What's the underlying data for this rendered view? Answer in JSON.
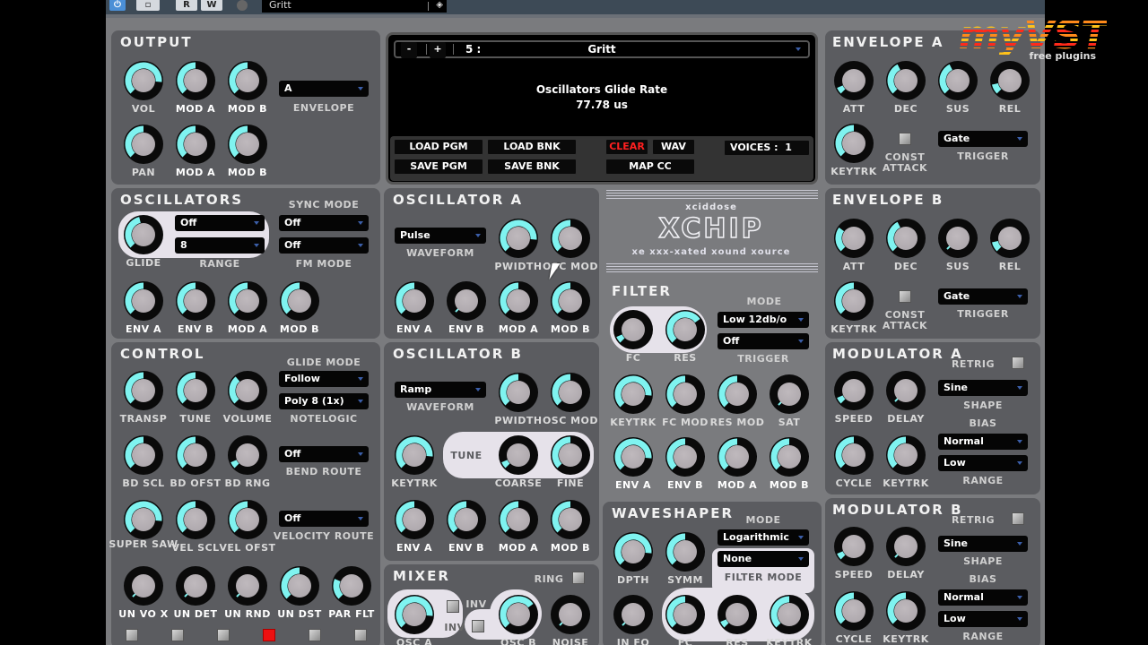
{
  "host": {
    "buttons": [
      "⏻",
      "▫",
      "R",
      "W"
    ],
    "preset_name": "Gritt"
  },
  "watermark": {
    "brand": "myVST",
    "tagline": "free plugins"
  },
  "display": {
    "prev": "-",
    "next": "+",
    "program_number": "5 :",
    "program_name": "Gritt",
    "param_name": "Oscillators Glide Rate",
    "param_value": "77.78 us",
    "load_pgm": "LOAD PGM",
    "load_bnk": "LOAD BNK",
    "save_pgm": "SAVE PGM",
    "save_bnk": "SAVE BNK",
    "clear": "CLEAR",
    "wav": "WAV",
    "map_cc": "MAP CC",
    "voices_label": "VOICES :",
    "voices_value": "1"
  },
  "logo": {
    "maker": "xciddose",
    "name": "XCHIP",
    "tagline": "xe xxx-xated xound xource"
  },
  "output": {
    "title": "OUTPUT",
    "knobs": [
      {
        "label": "VOL",
        "value": 0.85
      },
      {
        "label": "MOD A",
        "value": 0.5
      },
      {
        "label": "MOD B",
        "value": 0.5
      },
      {
        "label": "PAN",
        "value": 0.5
      },
      {
        "label": "MOD A",
        "value": 0.5
      },
      {
        "label": "MOD B",
        "value": 0.5
      }
    ],
    "envelope_select": "A",
    "envelope_label": "ENVELOPE"
  },
  "oscillators": {
    "title": "OSCILLATORS",
    "glide": {
      "label": "GLIDE",
      "value": 0.45
    },
    "range_selects": [
      "Off",
      "8"
    ],
    "range_label": "RANGE",
    "sync_label": "SYNC MODE",
    "sync_select": "Off",
    "fm_select": "Off",
    "fm_label": "FM MODE",
    "knobs": [
      {
        "label": "ENV A",
        "value": 0.5
      },
      {
        "label": "ENV B",
        "value": 0.5
      },
      {
        "label": "MOD A",
        "value": 0.5
      },
      {
        "label": "MOD B",
        "value": 0.5
      }
    ]
  },
  "control": {
    "title": "CONTROL",
    "knobs": [
      {
        "label": "TRANSP",
        "value": 0.5
      },
      {
        "label": "TUNE",
        "value": 0.5
      },
      {
        "label": "VOLUME",
        "value": 0.35
      },
      {
        "label": "BD SCL",
        "value": 0.5
      },
      {
        "label": "BD OFST",
        "value": 0.5
      },
      {
        "label": "BD RNG",
        "value": 0.08
      },
      {
        "label": "SUPER SAW",
        "value": 0.85
      },
      {
        "label": "VEL SCL",
        "value": 0.5
      },
      {
        "label": "VEL OFST",
        "value": 0.5
      },
      {
        "label": "UN VO X",
        "value": 0.0
      },
      {
        "label": "UN DET",
        "value": 0.0
      },
      {
        "label": "UN RND",
        "value": 0.0
      },
      {
        "label": "UN DST",
        "value": 0.5
      },
      {
        "label": "PAR FLT",
        "value": 0.25
      }
    ],
    "glide_mode_label": "GLIDE MODE",
    "glide_mode": "Follow",
    "notelogic": "Poly 8 (1x)",
    "notelogic_label": "NOTELOGIC",
    "bend_route": "Off",
    "bend_route_label": "BEND ROUTE",
    "velocity_route": "Off",
    "velocity_route_label": "VELOCITY ROUTE",
    "toggles": [
      false,
      false,
      false,
      true,
      false,
      false
    ]
  },
  "osc_a": {
    "title": "OSCILLATOR A",
    "waveform": "Pulse",
    "waveform_label": "WAVEFORM",
    "knobs": [
      {
        "label": "PWIDTH",
        "value": 0.85
      },
      {
        "label": "OSC MOD",
        "value": 0.5
      },
      {
        "label": "ENV A",
        "value": 0.5
      },
      {
        "label": "ENV B",
        "value": 0.0
      },
      {
        "label": "MOD A",
        "value": 0.5
      },
      {
        "label": "MOD B",
        "value": 0.5
      }
    ]
  },
  "osc_b": {
    "title": "OSCILLATOR B",
    "waveform": "Ramp",
    "waveform_label": "WAVEFORM",
    "tune_label": "TUNE",
    "knobs": [
      {
        "label": "PWIDTH",
        "value": 0.5
      },
      {
        "label": "OSC MOD",
        "value": 0.5
      },
      {
        "label": "KEYTRK",
        "value": 0.85
      },
      {
        "label": "COARSE",
        "value": 0.08
      },
      {
        "label": "FINE",
        "value": 0.5
      },
      {
        "label": "ENV A",
        "value": 0.5
      },
      {
        "label": "ENV B",
        "value": 0.5
      },
      {
        "label": "MOD A",
        "value": 0.5
      },
      {
        "label": "MOD B",
        "value": 0.5
      }
    ]
  },
  "mixer": {
    "title": "MIXER",
    "ring_label": "RING",
    "inv_label": "INV",
    "knobs": [
      {
        "label": "OSC A",
        "value": 0.85
      },
      {
        "label": "OSC B",
        "value": 0.7
      },
      {
        "label": "NOISE",
        "value": 0.0
      }
    ]
  },
  "filter": {
    "title": "FILTER",
    "mode_label": "MODE",
    "mode": "Low 12db/o",
    "trigger": "Off",
    "trigger_label": "TRIGGER",
    "knobs": [
      {
        "label": "FC",
        "value": 0.08
      },
      {
        "label": "RES",
        "value": 0.7
      },
      {
        "label": "KEYTRK",
        "value": 0.85
      },
      {
        "label": "FC MOD",
        "value": 0.5
      },
      {
        "label": "RES MOD",
        "value": 0.5
      },
      {
        "label": "SAT",
        "value": 0.0
      },
      {
        "label": "ENV A",
        "value": 0.85
      },
      {
        "label": "ENV B",
        "value": 0.5
      },
      {
        "label": "MOD A",
        "value": 0.5
      },
      {
        "label": "MOD B",
        "value": 0.5
      }
    ]
  },
  "waveshaper": {
    "title": "WAVESHAPER",
    "mode_label": "MODE",
    "mode": "Logarithmic",
    "filter_mode": "None",
    "filter_mode_label": "FILTER MODE",
    "knobs": [
      {
        "label": "DPTH",
        "value": 0.85
      },
      {
        "label": "SYMM",
        "value": 0.5
      },
      {
        "label": "IN FQ",
        "value": 0.0
      },
      {
        "label": "FC",
        "value": 0.5
      },
      {
        "label": "RES",
        "value": 0.08
      },
      {
        "label": "KEYTRK",
        "value": 0.5
      }
    ]
  },
  "env_a": {
    "title": "ENVELOPE A",
    "knobs": [
      {
        "label": "ATT",
        "value": 0.08
      },
      {
        "label": "DEC",
        "value": 0.4
      },
      {
        "label": "SUS",
        "value": 0.4
      },
      {
        "label": "REL",
        "value": 0.12
      },
      {
        "label": "KEYTRK",
        "value": 0.5
      }
    ],
    "const_label": "CONST ATTACK",
    "trigger": "Gate",
    "trigger_label": "TRIGGER"
  },
  "env_b": {
    "title": "ENVELOPE B",
    "knobs": [
      {
        "label": "ATT",
        "value": 0.3
      },
      {
        "label": "DEC",
        "value": 0.4
      },
      {
        "label": "SUS",
        "value": 0.0
      },
      {
        "label": "REL",
        "value": 0.12
      },
      {
        "label": "KEYTRK",
        "value": 0.5
      }
    ],
    "const_label": "CONST ATTACK",
    "trigger": "Gate",
    "trigger_label": "TRIGGER"
  },
  "mod_a": {
    "title": "MODULATOR A",
    "retrig_label": "RETRIG",
    "knobs": [
      {
        "label": "SPEED",
        "value": 0.08
      },
      {
        "label": "DELAY",
        "value": 0.0
      },
      {
        "label": "CYCLE",
        "value": 0.5
      },
      {
        "label": "KEYTRK",
        "value": 0.5
      }
    ],
    "shape": "Sine",
    "shape_label": "SHAPE",
    "bias_label": "BIAS",
    "bias": "Normal",
    "range": "Low",
    "range_label": "RANGE"
  },
  "mod_b": {
    "title": "MODULATOR B",
    "retrig_label": "RETRIG",
    "knobs": [
      {
        "label": "SPEED",
        "value": 0.08
      },
      {
        "label": "DELAY",
        "value": 0.0
      },
      {
        "label": "CYCLE",
        "value": 0.5
      },
      {
        "label": "KEYTRK",
        "value": 0.5
      }
    ],
    "shape": "Sine",
    "shape_label": "SHAPE",
    "bias_label": "BIAS",
    "bias": "Normal",
    "range": "Low",
    "range_label": "RANGE"
  },
  "colors": {
    "knob_arc": "#7ff3f0",
    "knob_track": "#0a0a0a",
    "panel": "#5b5c60",
    "clear": "#ff2020"
  }
}
